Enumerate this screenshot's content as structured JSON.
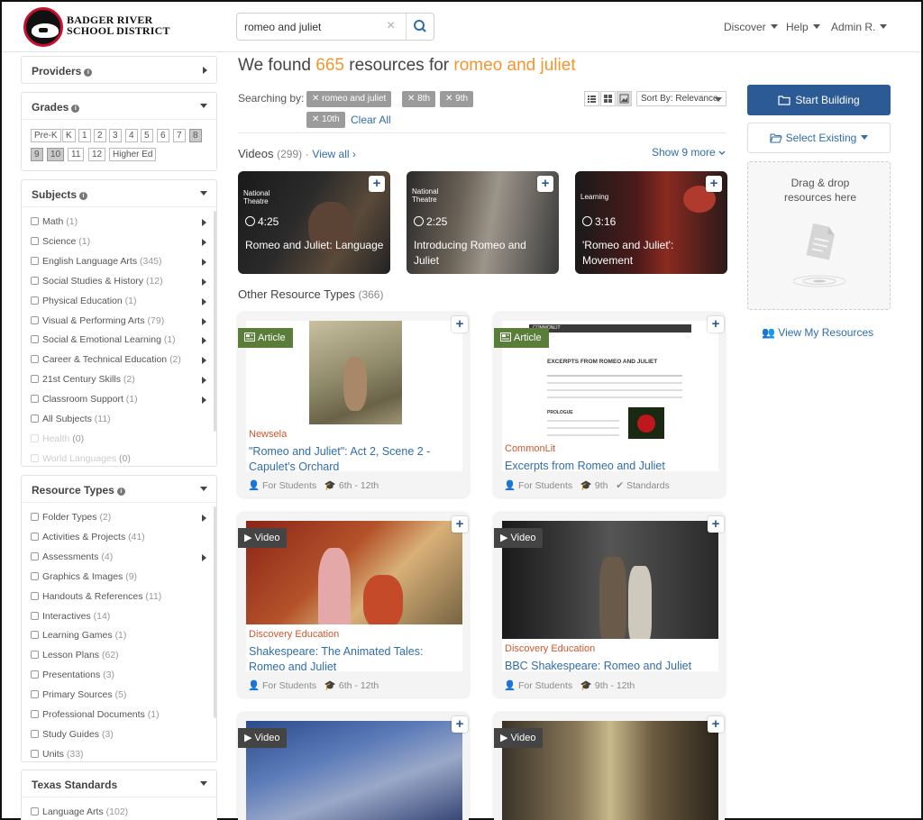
{
  "header": {
    "logo_line1": "BADGER RIVER",
    "logo_line2": "SCHOOL DISTRICT",
    "search_value": "romeo and juliet",
    "nav": [
      "Discover",
      "Help",
      "Admin R."
    ]
  },
  "sidebar": {
    "providers": {
      "title": "Providers"
    },
    "grades": {
      "title": "Grades",
      "items": [
        {
          "label": "Pre-K",
          "selected": false
        },
        {
          "label": "K",
          "selected": false
        },
        {
          "label": "1",
          "selected": false
        },
        {
          "label": "2",
          "selected": false
        },
        {
          "label": "3",
          "selected": false
        },
        {
          "label": "4",
          "selected": false
        },
        {
          "label": "5",
          "selected": false
        },
        {
          "label": "6",
          "selected": false
        },
        {
          "label": "7",
          "selected": false
        },
        {
          "label": "8",
          "selected": true
        },
        {
          "label": "9",
          "selected": true
        },
        {
          "label": "10",
          "selected": true
        },
        {
          "label": "11",
          "selected": false
        },
        {
          "label": "12",
          "selected": false
        },
        {
          "label": "Higher Ed",
          "selected": false
        }
      ]
    },
    "subjects": {
      "title": "Subjects",
      "items": [
        {
          "label": "Math",
          "count": "(1)",
          "arrow": true
        },
        {
          "label": "Science",
          "count": "(1)",
          "arrow": true
        },
        {
          "label": "English Language Arts",
          "count": "(345)",
          "arrow": true
        },
        {
          "label": "Social Studies & History",
          "count": "(12)",
          "arrow": true
        },
        {
          "label": "Physical Education",
          "count": "(1)",
          "arrow": true
        },
        {
          "label": "Visual & Performing Arts",
          "count": "(79)",
          "arrow": true
        },
        {
          "label": "Social & Emotional Learning",
          "count": "(1)",
          "arrow": true
        },
        {
          "label": "Career & Technical Education",
          "count": "(2)",
          "arrow": true
        },
        {
          "label": "21st Century Skills",
          "count": "(2)",
          "arrow": true
        },
        {
          "label": "Classroom Support",
          "count": "(1)",
          "arrow": true
        },
        {
          "label": "All Subjects",
          "count": "(11)",
          "arrow": false
        },
        {
          "label": "Health",
          "count": "(0)",
          "arrow": false,
          "dim": true
        },
        {
          "label": "World Languages",
          "count": "(0)",
          "arrow": false,
          "dim": true
        }
      ]
    },
    "resource_types": {
      "title": "Resource Types",
      "items": [
        {
          "label": "Folder Types",
          "count": "(2)",
          "arrow": true
        },
        {
          "label": "Activities & Projects",
          "count": "(41)",
          "arrow": false
        },
        {
          "label": "Assessments",
          "count": "(4)",
          "arrow": true
        },
        {
          "label": "Graphics & Images",
          "count": "(9)",
          "arrow": false
        },
        {
          "label": "Handouts & References",
          "count": "(11)",
          "arrow": false
        },
        {
          "label": "Interactives",
          "count": "(14)",
          "arrow": false
        },
        {
          "label": "Learning Games",
          "count": "(1)",
          "arrow": false
        },
        {
          "label": "Lesson Plans",
          "count": "(62)",
          "arrow": false
        },
        {
          "label": "Presentations",
          "count": "(3)",
          "arrow": false
        },
        {
          "label": "Primary Sources",
          "count": "(5)",
          "arrow": false
        },
        {
          "label": "Professional Documents",
          "count": "(1)",
          "arrow": false
        },
        {
          "label": "Study Guides",
          "count": "(3)",
          "arrow": false
        },
        {
          "label": "Units",
          "count": "(33)",
          "arrow": false
        }
      ]
    },
    "standards": {
      "title": "Texas Standards",
      "items": [
        {
          "label": "Language Arts",
          "count": "(102)"
        }
      ]
    }
  },
  "results": {
    "prefix": "We found",
    "count": "665",
    "middle": "resources for",
    "query": "romeo and juliet",
    "searching_by_label": "Searching by:",
    "filters": [
      "romeo and juliet",
      "8th",
      "9th",
      "10th"
    ],
    "clear_all": "Clear All",
    "sort_label": "Sort By: Relevance"
  },
  "videos": {
    "title": "Videos",
    "count": "(299)",
    "view_all": "View all ›",
    "show_more": "Show 9 more",
    "items": [
      {
        "duration": "4:25",
        "title": "Romeo and Juliet: Language",
        "overlay": "National Theatre"
      },
      {
        "duration": "2:25",
        "title": "Introducing Romeo and Juliet",
        "overlay": "National Theatre"
      },
      {
        "duration": "3:16",
        "title": "'Romeo and Juliet': Movement",
        "overlay": "Learning"
      }
    ]
  },
  "other": {
    "title": "Other Resource Types",
    "count": "(366)",
    "cards": [
      {
        "tag": "Article",
        "provider": "Newsela",
        "title": "\"Romeo and Juliet\": Act 2, Scene 2 - Capulet's Orchard",
        "audience": "For Students",
        "grades": "6th - 12th",
        "standards": ""
      },
      {
        "tag": "Article",
        "provider": "CommonLit",
        "title": "Excerpts from Romeo and Juliet",
        "audience": "For Students",
        "grades": "9th",
        "standards": "Standards",
        "doc_heading": "EXCERPTS FROM ROMEO AND JULIET",
        "doc_brand": "COMMONLIT",
        "doc_section": "PROLOGUE"
      },
      {
        "tag": "Video",
        "provider": "Discovery Education",
        "title": "Shakespeare: The Animated Tales: Romeo and Juliet",
        "audience": "For Students",
        "grades": "6th - 12th",
        "standards": ""
      },
      {
        "tag": "Video",
        "provider": "Discovery Education",
        "title": "BBC Shakespeare: Romeo and Juliet",
        "audience": "For Students",
        "grades": "9th - 12th",
        "standards": ""
      },
      {
        "tag": "Video"
      },
      {
        "tag": "Video"
      }
    ]
  },
  "builder": {
    "start": "Start Building",
    "select": "Select Existing",
    "drop_hint": "Drag & drop resources here",
    "view_my": "View My Resources"
  },
  "colors": {
    "accent": "#f4962e",
    "primary": "#2b5a95",
    "link": "#2f6dab",
    "provider": "#d4552c",
    "article_tag": "#5a7d3a"
  }
}
